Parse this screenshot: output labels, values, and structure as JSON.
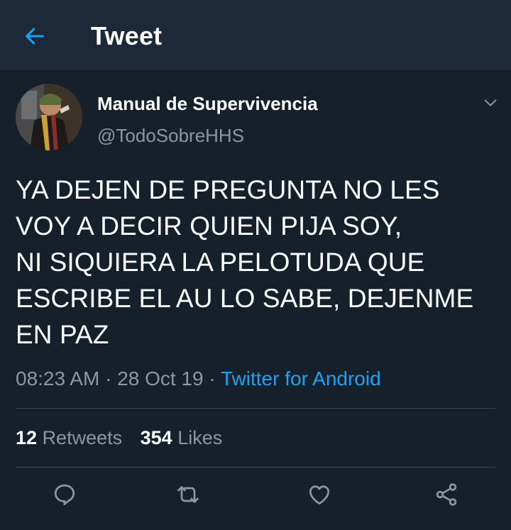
{
  "header": {
    "title": "Tweet",
    "back_icon": "arrow-left-icon"
  },
  "colors": {
    "background": "#15202b",
    "header_background": "#1c2938",
    "accent": "#1da1f2",
    "secondary_text": "#8899a6",
    "divider": "#38444d"
  },
  "tweet": {
    "author": {
      "display_name": "Manual de Supervivencia",
      "handle": "@TodoSobreHHS"
    },
    "text": "YA DEJEN DE PREGUNTA NO LES\nVOY A DECIR QUIEN PIJA SOY,\nNI SIQUIERA LA PELOTUDA QUE\nESCRIBE EL AU LO SABE, DEJENME\nEN PAZ",
    "time": "08:23 AM",
    "separator": "·",
    "date": "28 Oct 19",
    "source": "Twitter for Android",
    "stats": {
      "retweets_count": "12",
      "retweets_label": "Retweets",
      "likes_count": "354",
      "likes_label": "Likes"
    }
  },
  "actions": [
    "reply-icon",
    "retweet-icon",
    "like-icon",
    "share-icon"
  ]
}
